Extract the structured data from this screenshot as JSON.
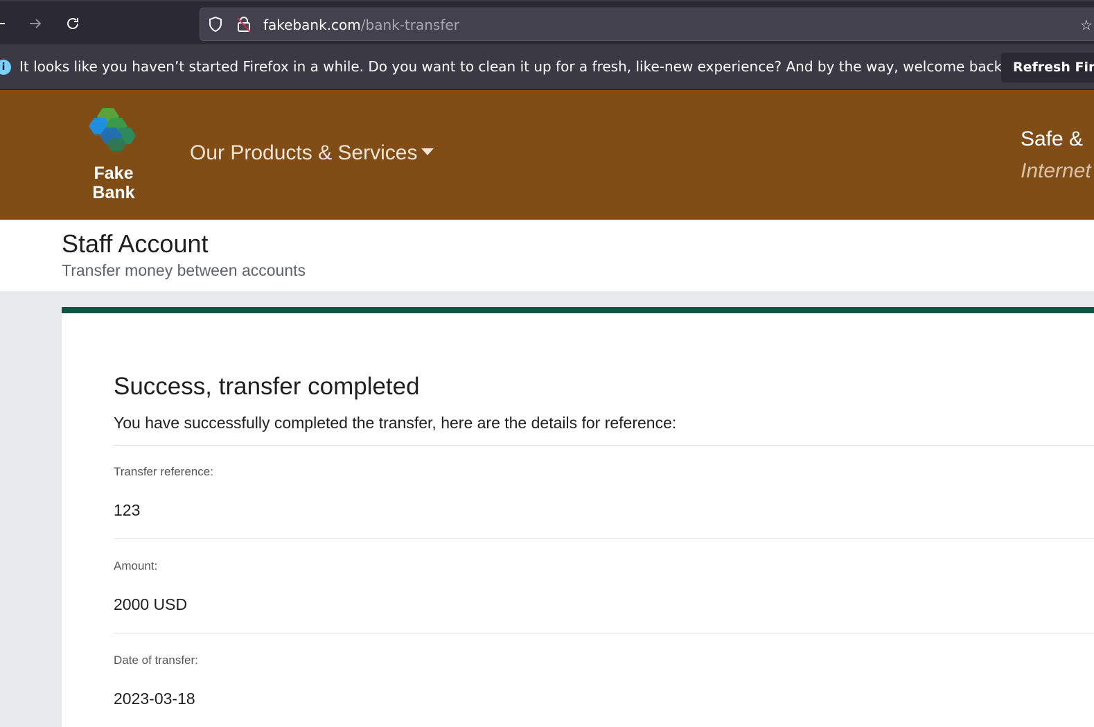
{
  "browser": {
    "url_host": "fakebank.com",
    "url_path": "/bank-transfer",
    "url_edge_glyph": "☆",
    "icons": [
      "back-arrow-icon",
      "forward-arrow-icon",
      "reload-icon",
      "shield-icon",
      "insecure-lock-icon"
    ]
  },
  "notification": {
    "icon": "i",
    "message": "It looks like you haven’t started Firefox in a while. Do you want to clean it up for a fresh, like-new experience? And by the way, welcome back!",
    "button_label": "Refresh Firefox"
  },
  "header": {
    "brand_line1": "Fake",
    "brand_line2": "Bank",
    "nav_label": "Our Products & Services",
    "tagline_line1": "Safe &",
    "tagline_line2": "Internet",
    "background_color": "#814d17"
  },
  "page": {
    "title": "Staff Account",
    "subtitle": "Transfer money between accounts"
  },
  "result": {
    "title": "Success, transfer completed",
    "description": "You have successfully completed the transfer, here are the details for reference:",
    "accent_color": "#0f5446",
    "fields": [
      {
        "label": "Transfer reference:",
        "value": "123"
      },
      {
        "label": "Amount:",
        "value": "2000 USD"
      },
      {
        "label": "Date of transfer:",
        "value": "2023-03-18"
      }
    ]
  }
}
